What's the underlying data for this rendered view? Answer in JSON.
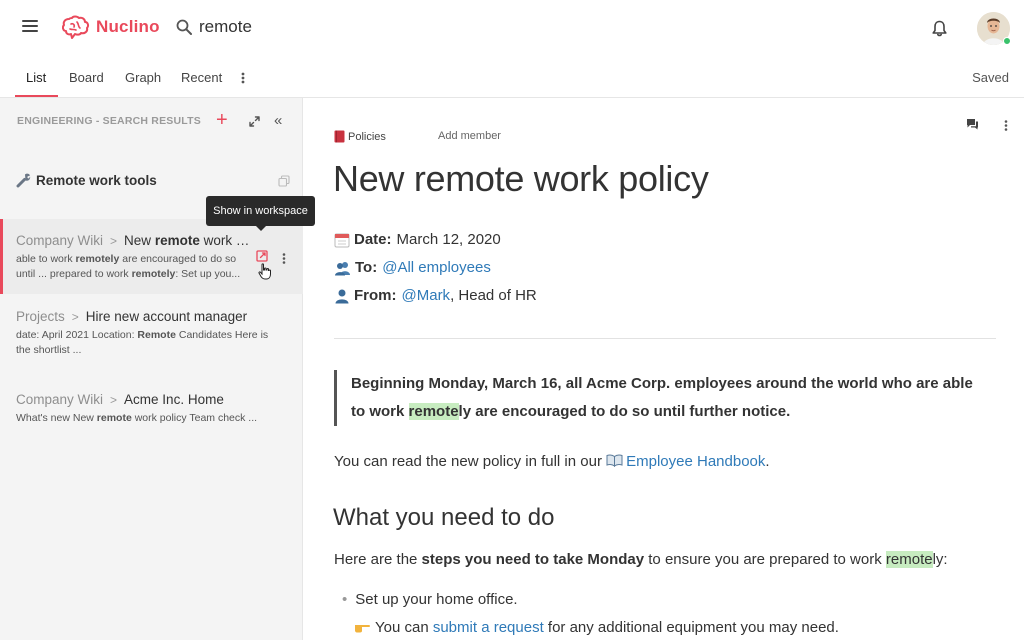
{
  "app": {
    "name": "Nuclino"
  },
  "search": {
    "query": "remote"
  },
  "tabs": [
    {
      "label": "List"
    },
    {
      "label": "Board"
    },
    {
      "label": "Graph"
    },
    {
      "label": "Recent"
    }
  ],
  "status": {
    "saved": "Saved"
  },
  "sidebar": {
    "heading": "ENGINEERING - SEARCH RESULTS",
    "pinned": {
      "label": "Remote work tools"
    },
    "tooltip": "Show in workspace",
    "results": [
      {
        "crumb": "Company Wiki",
        "title_pre": "New ",
        "title_bold": "remote",
        "title_post": " work policy",
        "snippet_line1": [
          "able to work ",
          "remotely",
          " are encouraged to do so"
        ],
        "snippet_line2": [
          "until ... prepared to work ",
          "remotely",
          ": Set up you..."
        ]
      },
      {
        "crumb": "Projects",
        "title": "Hire new account manager",
        "snippet_line1": [
          "date: April 2021 Location: ",
          "Remote",
          " Candidates Here is"
        ],
        "snippet_line2": [
          "the shortlist ..."
        ]
      },
      {
        "crumb": "Company Wiki",
        "title": "Acme Inc. Home",
        "snippet_line1": [
          "What's new New ",
          "remote",
          " work policy Team check ..."
        ]
      }
    ]
  },
  "document": {
    "breadcrumb": "Policies",
    "add_member": "Add member",
    "title": "New remote work policy",
    "date_label": "Date:",
    "date_value": "March 12, 2020",
    "to_label": "To:",
    "to_value": "@All employees",
    "from_label": "From:",
    "from_mention": "@Mark",
    "from_rest": ", Head of HR",
    "quote_line1": "Beginning Monday, March 16, all Acme Corp. employees around the world who are able",
    "quote_line2_pre": "to work ",
    "quote_line2_hl": "remote",
    "quote_line2_post": "ly are encouraged to do so until further notice.",
    "read_pre": "You can read the new policy in full in our ",
    "read_link": "Employee Handbook",
    "read_post": ".",
    "h2": "What you need to do",
    "steps_pre": "Here are the ",
    "steps_bold": "steps you need to take Monday",
    "steps_mid": " to ensure you are prepared to work ",
    "steps_hl": "remote",
    "steps_post": "ly:",
    "bullet1": "Set up your home office.",
    "sub_pre": "You can ",
    "sub_link": "submit a request",
    "sub_post": " for any additional equipment you may need."
  },
  "colors": {
    "accent": "#e9495b",
    "link": "#2f7ab8",
    "highlight": "#c7ecc0"
  },
  "icons": [
    "hamburger-icon",
    "brain-logo-icon",
    "search-icon",
    "bell-icon",
    "plus-icon",
    "expand-icon",
    "collapse-icon",
    "wrench-icon",
    "copy-icon",
    "open-in-workspace-icon",
    "more-vertical-icon",
    "comment-icon",
    "book-icon",
    "calendar-icon",
    "people-icon",
    "person-icon",
    "pointing-hand-icon"
  ]
}
